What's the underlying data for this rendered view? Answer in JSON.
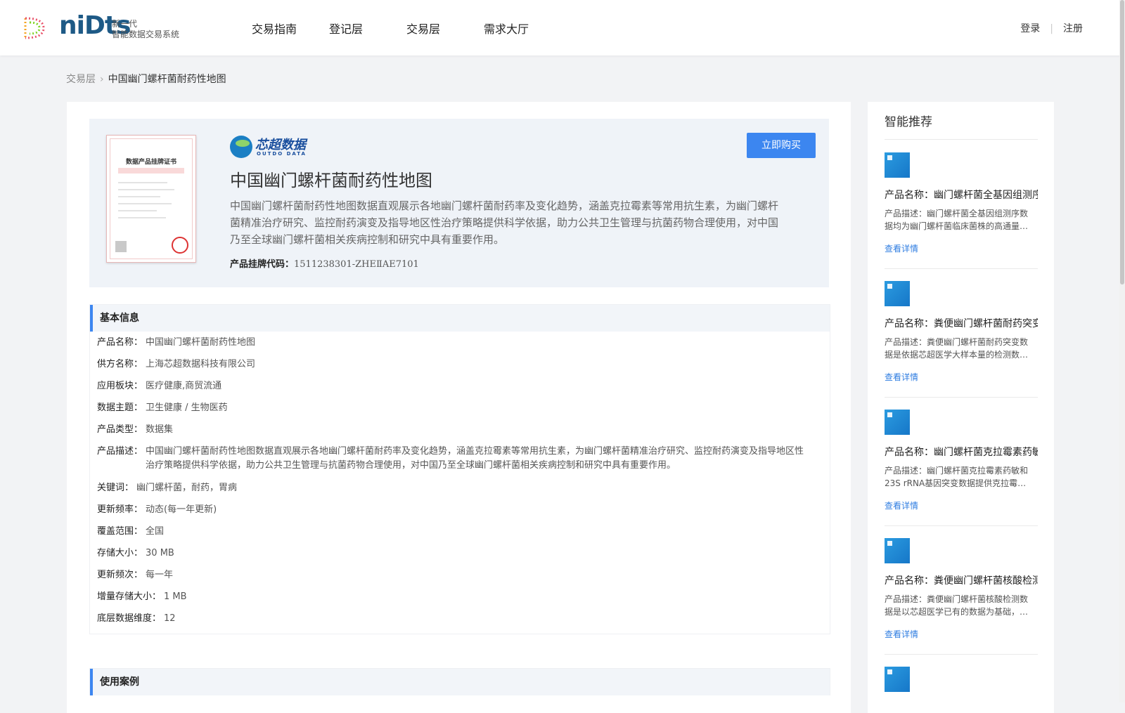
{
  "header": {
    "logo_word": "niDts",
    "logo_sub_line1": "新一代",
    "logo_sub_line2": "智能数据交易系统",
    "nav": [
      "交易指南",
      "登记层",
      "交易层",
      "需求大厅"
    ],
    "login": "登录",
    "register": "注册"
  },
  "breadcrumb": {
    "parent": "交易层",
    "current": "中国幽门螺杆菌耐药性地图"
  },
  "summary": {
    "cert_title": "数据产品挂牌证书",
    "brand_name": "芯超数据",
    "brand_en": "OUTDO DATA",
    "buy_label": "立即购买",
    "title": "中国幽门螺杆菌耐药性地图",
    "description": "中国幽门螺杆菌耐药性地图数据直观展示各地幽门螺杆菌耐药率及变化趋势，涵盖克拉霉素等常用抗生素，为幽门螺杆菌精准治疗研究、监控耐药演变及指导地区性治疗策略提供科学依据，助力公共卫生管理与抗菌药物合理使用，对中国乃至全球幽门螺杆菌相关疾病控制和研究中具有重要作用。",
    "code_label": "产品挂牌代码：",
    "code_value": "1511238301-ZHEⅡAE7101"
  },
  "basic_info": {
    "heading": "基本信息",
    "rows": [
      {
        "k": "产品名称：",
        "v": "中国幽门螺杆菌耐药性地图"
      },
      {
        "k": "供方名称：",
        "v": "上海芯超数据科技有限公司"
      },
      {
        "k": "应用板块：",
        "v": "医疗健康,商贸流通"
      },
      {
        "k": "数据主题：",
        "v": "卫生健康 / 生物医药"
      },
      {
        "k": "产品类型：",
        "v": "数据集"
      },
      {
        "k": "产品描述：",
        "v": "中国幽门螺杆菌耐药性地图数据直观展示各地幽门螺杆菌耐药率及变化趋势，涵盖克拉霉素等常用抗生素，为幽门螺杆菌精准治疗研究、监控耐药演变及指导地区性治疗策略提供科学依据，助力公共卫生管理与抗菌药物合理使用，对中国乃至全球幽门螺杆菌相关疾病控制和研究中具有重要作用。"
      },
      {
        "k": "关键词：",
        "v": "幽门螺杆菌，耐药，胃病"
      },
      {
        "k": "更新频率：",
        "v": "动态(每一年更新)"
      },
      {
        "k": "覆盖范围：",
        "v": "全国"
      },
      {
        "k": "存储大小：",
        "v": "30 MB"
      },
      {
        "k": "更新频次：",
        "v": "每一年"
      },
      {
        "k": "增量存储大小：",
        "v": "1 MB"
      },
      {
        "k": "底层数据维度：",
        "v": "12"
      }
    ]
  },
  "use_cases": {
    "heading": "使用案例"
  },
  "side": {
    "title": "智能推荐",
    "link_label": "查看详情",
    "items": [
      {
        "name": "产品名称：幽门螺杆菌全基因组测序数据",
        "desc": "产品描述：幽门螺杆菌全基因组测序数据均为幽门螺杆菌临床菌株的高通量测序数据"
      },
      {
        "name": "产品名称：粪便幽门螺杆菌耐药突变数据",
        "desc": "产品描述：粪便幽门螺杆菌耐药突变数据是依据芯超医学大样本量的检测数据整理而成"
      },
      {
        "name": "产品名称：幽门螺杆菌克拉霉素药敏数据",
        "desc": "产品描述：幽门螺杆菌克拉霉素药敏和23S rRNA基因突变数据提供克拉霉素耐药相关信息"
      },
      {
        "name": "产品名称：粪便幽门螺杆菌核酸检测数据",
        "desc": "产品描述：粪便幽门螺杆菌核酸检测数据是以芯超医学已有的数据为基础，进行整理"
      }
    ]
  }
}
